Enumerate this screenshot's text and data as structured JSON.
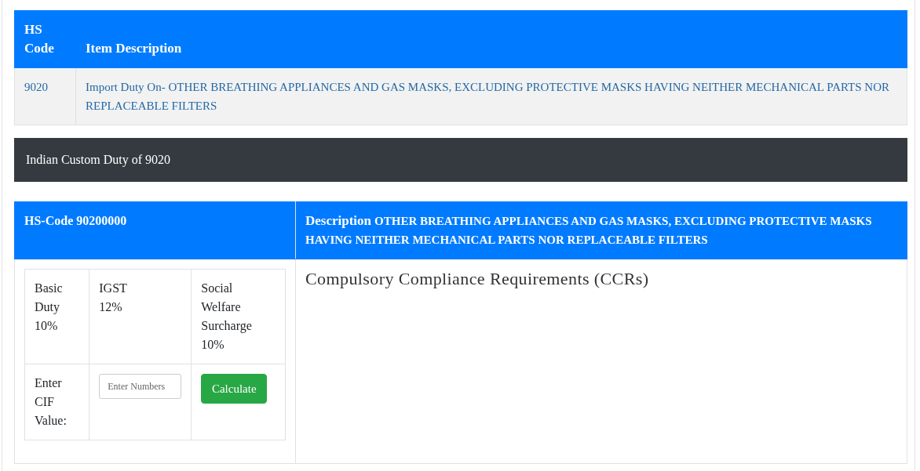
{
  "item_table": {
    "columns": [
      "HS Code",
      "Item Description"
    ],
    "rows": [
      {
        "hs_code": "9020",
        "description": "Import Duty On- OTHER BREATHING APPLIANCES AND GAS MASKS, EXCLUDING PROTECTIVE MASKS HAVING NEITHER MECHANICAL PARTS NOR REPLACEABLE FILTERS"
      }
    ]
  },
  "duty_heading": "Indian Custom Duty of 9020",
  "detail": {
    "hs_code_header": "HS-Code 90200000",
    "description_label": "Description",
    "description": "OTHER BREATHING APPLIANCES AND GAS MASKS, EXCLUDING PROTECTIVE MASKS HAVING NEITHER MECHANICAL PARTS NOR REPLACEABLE FILTERS",
    "rates": [
      {
        "label": "Basic Duty",
        "value": "10%"
      },
      {
        "label": "IGST",
        "value": "12%"
      },
      {
        "label": "Social Welfare Surcharge",
        "value": "10%"
      }
    ],
    "cif_label": "Enter CIF Value:",
    "cif_input": {
      "placeholder": "Enter Numbers"
    },
    "calculate_button": "Calculate",
    "ccr_heading": "Compulsory Compliance Requirements (CCRs)"
  }
}
